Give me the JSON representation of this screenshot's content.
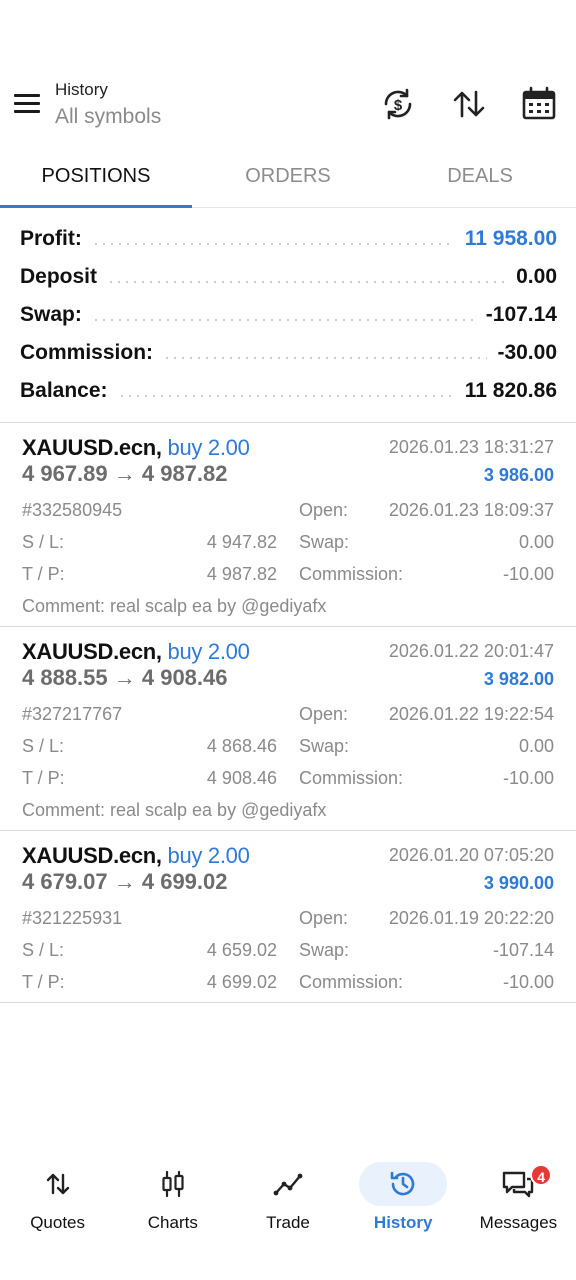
{
  "header": {
    "title": "History",
    "subtitle": "All symbols",
    "icons": [
      "menu-icon",
      "dollar-sync-icon",
      "sort-icon",
      "calendar-icon"
    ]
  },
  "tabs": [
    {
      "label": "POSITIONS",
      "active": true
    },
    {
      "label": "ORDERS",
      "active": false
    },
    {
      "label": "DEALS",
      "active": false
    }
  ],
  "summary": {
    "profit_label": "Profit:",
    "profit_value": "11 958.00",
    "deposit_label": "Deposit",
    "deposit_value": "0.00",
    "swap_label": "Swap:",
    "swap_value": "-107.14",
    "commission_label": "Commission:",
    "commission_value": "-30.00",
    "balance_label": "Balance:",
    "balance_value": "11 820.86"
  },
  "labels": {
    "sl": "S / L:",
    "tp": "T / P:",
    "open": "Open:",
    "swap": "Swap:",
    "commission": "Commission:",
    "comment": "Comment:"
  },
  "positions": [
    {
      "symbol": "XAUUSD.ecn,",
      "side": "buy 2.00",
      "close_time": "2026.01.23 18:31:27",
      "price_range": "4 967.89 → 4 987.82",
      "profit": "3 986.00",
      "ticket": "#332580945",
      "open_time": "2026.01.23 18:09:37",
      "sl": "4 947.82",
      "tp": "4 987.82",
      "swap": "0.00",
      "commission": "-10.00",
      "comment": "real scalp ea by @gediyafx"
    },
    {
      "symbol": "XAUUSD.ecn,",
      "side": "buy 2.00",
      "close_time": "2026.01.22 20:01:47",
      "price_range": "4 888.55 → 4 908.46",
      "profit": "3 982.00",
      "ticket": "#327217767",
      "open_time": "2026.01.22 19:22:54",
      "sl": "4 868.46",
      "tp": "4 908.46",
      "swap": "0.00",
      "commission": "-10.00",
      "comment": "real scalp ea by @gediyafx"
    },
    {
      "symbol": "XAUUSD.ecn,",
      "side": "buy 2.00",
      "close_time": "2026.01.20 07:05:20",
      "price_range": "4 679.07 → 4 699.02",
      "profit": "3 990.00",
      "ticket": "#321225931",
      "open_time": "2026.01.19 20:22:20",
      "sl": "4 659.02",
      "tp": "4 699.02",
      "swap": "-107.14",
      "commission": "-10.00",
      "comment": ""
    }
  ],
  "nav": [
    {
      "label": "Quotes",
      "icon": "quotes-icon",
      "active": false
    },
    {
      "label": "Charts",
      "icon": "charts-icon",
      "active": false
    },
    {
      "label": "Trade",
      "icon": "trade-icon",
      "active": false
    },
    {
      "label": "History",
      "icon": "history-icon",
      "active": true
    },
    {
      "label": "Messages",
      "icon": "messages-icon",
      "active": false,
      "badge": "4"
    }
  ],
  "colors": {
    "accent": "#2e7ad6",
    "badge": "#e53935"
  }
}
